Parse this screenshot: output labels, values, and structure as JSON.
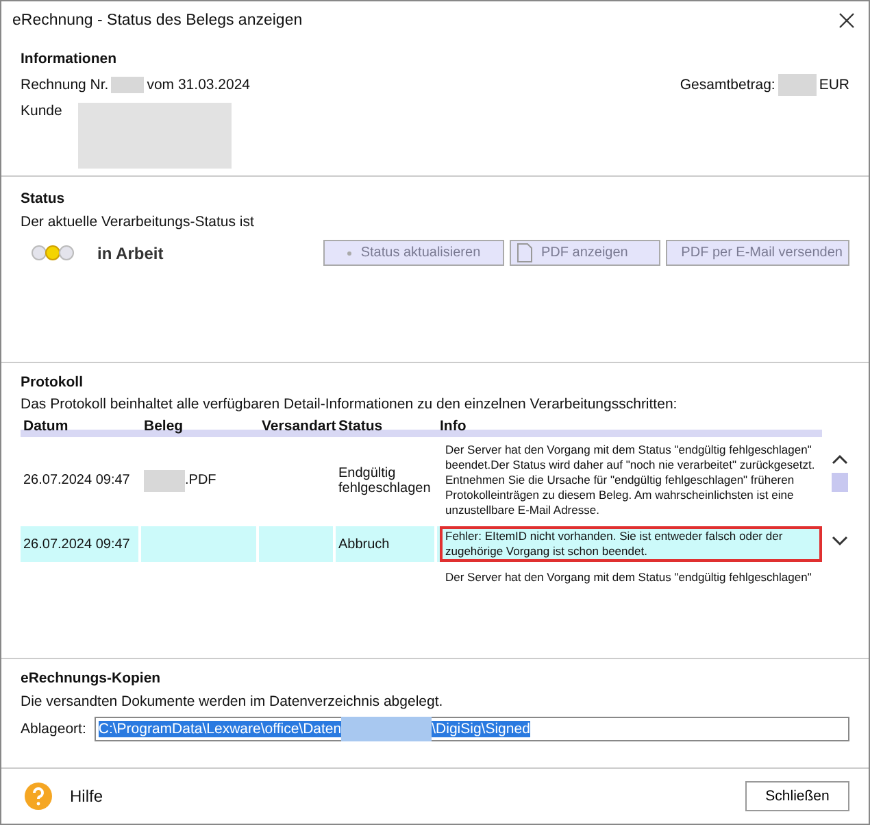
{
  "window": {
    "title": "eRechnung - Status des Belegs anzeigen"
  },
  "informationen": {
    "heading": "Informationen",
    "invoice_label": "Rechnung Nr.",
    "invoice_date": "vom 31.03.2024",
    "total_label": "Gesamtbetrag:",
    "currency": "EUR",
    "customer_label": "Kunde"
  },
  "status": {
    "heading": "Status",
    "description": "Der aktuelle Verarbeitungs-Status ist",
    "lights": [
      {
        "on": false
      },
      {
        "on": true
      },
      {
        "on": false
      }
    ],
    "value": "in Arbeit",
    "buttons": [
      {
        "label": "Status aktualisieren",
        "disabled": true
      },
      {
        "label": "PDF anzeigen",
        "disabled": true
      },
      {
        "label": "PDF per E-Mail versenden",
        "disabled": true
      }
    ]
  },
  "protokoll": {
    "heading": "Protokoll",
    "description": "Das Protokoll beinhaltet alle verfügbaren Detail-Informationen zu den einzelnen Verarbeitungsschritten:",
    "columns": [
      "Datum",
      "Beleg",
      "Versandart",
      "Status",
      "Info"
    ],
    "rows": [
      {
        "datum": "26.07.2024 09:47",
        "beleg": ".PDF",
        "beleg_redacted": true,
        "versandart": "",
        "status": "Endgültig fehlgeschlagen",
        "info": "Der Server hat den Vorgang mit dem Status \"endgültig fehlgeschlagen\" beendet.Der Status wird daher auf \"noch nie verarbeitet\" zurückgesetzt. Entnehmen Sie die Ursache für \"endgültig fehlgeschlagen\" früheren Protokolleinträgen zu diesem Beleg. Am wahrscheinlichsten ist eine unzustellbare E-Mail Adresse.",
        "selected": false,
        "highlighted": false
      },
      {
        "datum": "26.07.2024 09:47",
        "beleg": "",
        "beleg_redacted": false,
        "versandart": "",
        "status": "Abbruch",
        "info": "Fehler: EItemID nicht vorhanden. Sie ist entweder falsch oder der zugehörige Vorgang ist schon beendet.",
        "selected": true,
        "highlighted": true
      },
      {
        "datum": "",
        "beleg": "",
        "beleg_redacted": false,
        "versandart": "",
        "status": "",
        "info": "Der Server hat den Vorgang mit dem Status \"endgültig fehlgeschlagen\"",
        "selected": false,
        "highlighted": false
      }
    ]
  },
  "kopien": {
    "heading": "eRechnungs-Kopien",
    "description": "Die versandten Dokumente werden im Datenverzeichnis abgelegt.",
    "path_label": "Ablageort:",
    "path_start": "C:\\ProgramData\\Lexware\\office\\Daten",
    "path_end": "\\DigiSig\\Signed"
  },
  "footer": {
    "help": "Hilfe",
    "close": "Schließen"
  }
}
